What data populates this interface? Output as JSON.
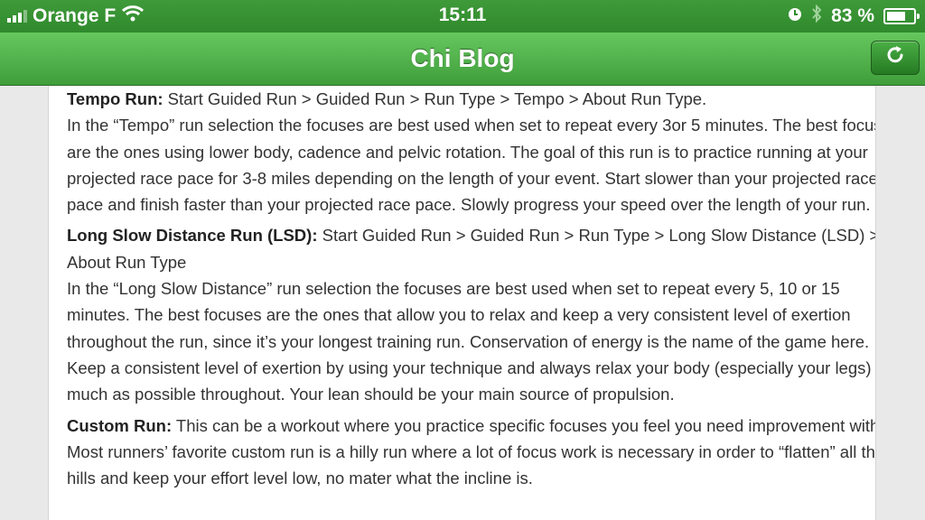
{
  "status_bar": {
    "carrier": "Orange F",
    "time": "15:11",
    "battery_percent": "83 %",
    "battery_level": 0.83,
    "icons": [
      "signal-icon",
      "wifi-icon",
      "clock-icon",
      "bluetooth-icon",
      "battery-icon"
    ]
  },
  "nav_bar": {
    "title": "Chi Blog",
    "refresh_icon": "refresh-icon"
  },
  "colors": {
    "nav_green": "#4fb449",
    "status_green": "#369232",
    "text": "#333333"
  },
  "article": {
    "sections": [
      {
        "heading": "Tempo Run:",
        "path": " Start Guided Run > Guided Run > Run Type > Tempo > About Run Type.",
        "body": "In the “Tempo” run selection the focuses are best used when set to repeat every 3or 5 minutes. The best focuses are the ones using lower body, cadence and pelvic rotation. The goal of this run is to practice running at your projected race pace for 3-8 miles depending on the length of your event. Start slower than your projected race pace and finish faster than your projected race pace. Slowly progress your speed over the length of your run."
      },
      {
        "heading": "Long Slow Distance Run (LSD):",
        "path": " Start Guided Run > Guided Run > Run Type > Long Slow Distance (LSD) > About Run Type",
        "body": "In the “Long Slow Distance” run selection the focuses are best used when set to repeat every 5, 10 or 15 minutes. The best focuses are the ones that allow you to relax and keep a very consistent level of exertion throughout the run, since it’s your longest training run. Conservation of energy is the name of the game here. Keep a consistent level of exertion by using your technique and always relax your body (especially your legs) as much as possible throughout. Your lean should be your main source of propulsion."
      },
      {
        "heading": "Custom Run:",
        "path": "  This can be a workout where you practice specific focuses you feel you need improvement with. Most runners’ favorite custom run is a hilly run where a lot of focus work is necessary in order to “flatten” all those hills and keep your effort level low, no mater what the incline is.",
        "body": ""
      }
    ]
  }
}
